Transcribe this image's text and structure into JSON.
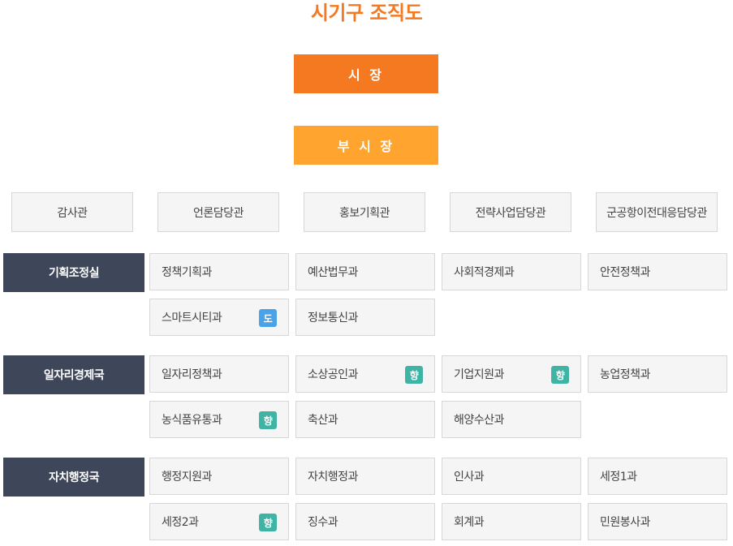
{
  "title": "시기구 조직도",
  "mayor": "시 장",
  "vice_mayor": "부 시 장",
  "staff_offices": [
    "감사관",
    "언론담당관",
    "홍보기획관",
    "전략사업담당관",
    "군공항이전대응담당관"
  ],
  "bureaus": [
    {
      "name": "기획조정실",
      "departments": [
        {
          "name": "정책기획과",
          "badge": ""
        },
        {
          "name": "예산법무과",
          "badge": ""
        },
        {
          "name": "사회적경제과",
          "badge": ""
        },
        {
          "name": "안전정책과",
          "badge": ""
        },
        {
          "name": "스마트시티과",
          "badge": "도"
        },
        {
          "name": "정보통신과",
          "badge": ""
        }
      ]
    },
    {
      "name": "일자리경제국",
      "departments": [
        {
          "name": "일자리정책과",
          "badge": ""
        },
        {
          "name": "소상공인과",
          "badge": "향"
        },
        {
          "name": "기업지원과",
          "badge": "향"
        },
        {
          "name": "농업정책과",
          "badge": ""
        },
        {
          "name": "농식품유통과",
          "badge": "향"
        },
        {
          "name": "축산과",
          "badge": ""
        },
        {
          "name": "해양수산과",
          "badge": ""
        }
      ]
    },
    {
      "name": "자치행정국",
      "departments": [
        {
          "name": "행정지원과",
          "badge": ""
        },
        {
          "name": "자치행정과",
          "badge": ""
        },
        {
          "name": "인사과",
          "badge": ""
        },
        {
          "name": "세정1과",
          "badge": ""
        },
        {
          "name": "세정2과",
          "badge": "향"
        },
        {
          "name": "징수과",
          "badge": ""
        },
        {
          "name": "회계과",
          "badge": ""
        },
        {
          "name": "민원봉사과",
          "badge": ""
        }
      ]
    }
  ],
  "colors": {
    "title": "#f47920",
    "mayor": "#f47920",
    "vice_mayor": "#ffa42e",
    "bureau": "#3e4759",
    "badge_do": "#4aa3e8",
    "badge_hyang": "#3fb4a5"
  }
}
